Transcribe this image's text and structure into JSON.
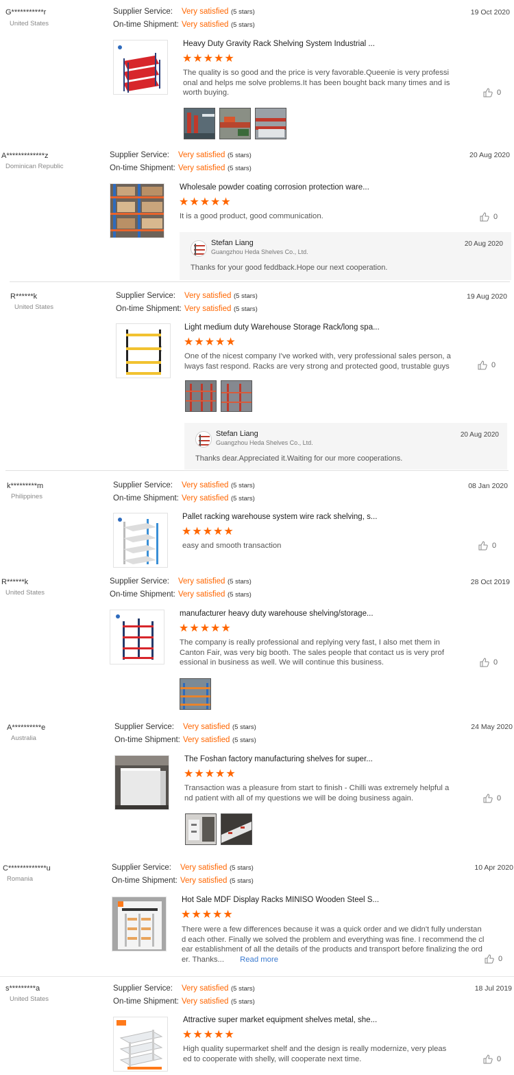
{
  "labels": {
    "supplier_service": "Supplier Service:",
    "ontime_shipment": "On-time Shipment:",
    "rating_value": "Very satisfied",
    "rating_stars": "(5 stars)",
    "stars": "★★★★★",
    "read_more": "Read more"
  },
  "colors": {
    "accent": "#ff6600",
    "link": "#3a7ad0"
  },
  "icons": {
    "like": "thumbs-up-icon"
  },
  "reviews": [
    {
      "user": "G***********r",
      "country": "United States",
      "date": "19 Oct 2020",
      "product": "Heavy Duty Gravity Rack Shelving System Industrial ...",
      "comment": "The quality is so good and the price is very favorable.Queenie is very professional and helps me solve problems.It has been bought back many times and is worth buying.",
      "likes": "0"
    },
    {
      "user": "A*************z",
      "country": "Dominican Republic",
      "date": "20 Aug 2020",
      "product": "Wholesale powder coating corrosion protection ware...",
      "comment": "It is a good product, good communication.",
      "likes": "0",
      "reply": {
        "name": "Stefan Liang",
        "company": "Guangzhou Heda Shelves Co., Ltd.",
        "date": "20 Aug 2020",
        "text": "Thanks for your good feddback.Hope our next cooperation."
      }
    },
    {
      "user": "R******k",
      "country": "United States",
      "date": "19 Aug 2020",
      "product": "Light medium duty Warehouse Storage Rack/long spa...",
      "comment": "One of the nicest company I've worked with, very  professional sales person, always fast respond. Racks are very strong and protected good, trustable guys",
      "likes": "0",
      "reply": {
        "name": "Stefan Liang",
        "company": "Guangzhou Heda Shelves Co., Ltd.",
        "date": "20 Aug 2020",
        "text": "Thanks dear.Appreciated it.Waiting for our more cooperations."
      }
    },
    {
      "user": "k*********m",
      "country": "Philippines",
      "date": "08 Jan 2020",
      "product": "Pallet racking warehouse system wire rack shelving, s...",
      "comment": "easy and smooth transaction",
      "likes": "0"
    },
    {
      "user": "R******k",
      "country": "United States",
      "date": "28 Oct 2019",
      "product": "manufacturer heavy duty warehouse shelving/storage...",
      "comment": "The company is really professional and replying very fast, I also met them in Canton Fair, was very big booth. The sales people that contact us is very professional in business as well. We will continue this business.",
      "likes": "0"
    },
    {
      "user": "A**********e",
      "country": "Australia",
      "date": "24 May 2020",
      "product": "The Foshan factory manufacturing shelves for super...",
      "comment": "Transaction was a pleasure from start to finish - Chilli was extremely helpful and patient with all of my questions we will be doing business again.",
      "likes": "0"
    },
    {
      "user": "C*************u",
      "country": "Romania",
      "date": "10 Apr 2020",
      "product": "Hot Sale MDF Display Racks MINISO Wooden Steel S...",
      "comment": "There were a few differences because it was a quick order and we didn't fully understand each other. Finally we solved the problem and everything was fine. I recommend the clear establishment of all the details of the products and transport before finalizing the order. Thanks...",
      "likes": "0"
    },
    {
      "user": "s*********a",
      "country": "United States",
      "date": "18 Jul 2019",
      "product": "Attractive super market equipment shelves metal, she...",
      "comment": "High quality supermarket shelf and the design is really modernize, very pleased to cooperate with shelly, will cooperate next time.",
      "likes": "0"
    }
  ]
}
